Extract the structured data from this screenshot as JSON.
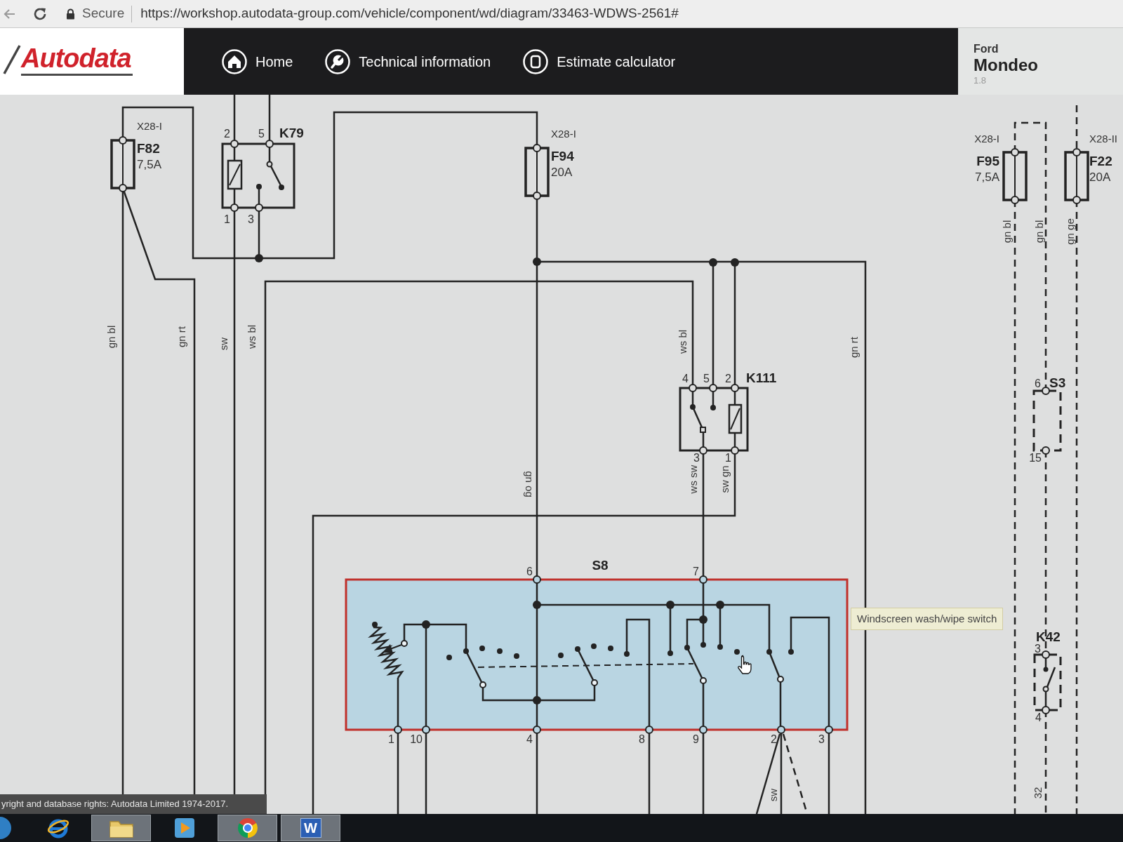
{
  "browser": {
    "security_label": "Secure",
    "url": "https://workshop.autodata-group.com/vehicle/component/wd/diagram/33463-WDWS-2561#"
  },
  "header": {
    "logo": "Autodata",
    "nav": [
      {
        "kind": "home",
        "label": "Home"
      },
      {
        "kind": "wrench",
        "label": "Technical information"
      },
      {
        "kind": "square",
        "label": "Estimate calculator"
      }
    ],
    "vehicle": {
      "make": "Ford",
      "model": "Mondeo",
      "engine": "1.8"
    }
  },
  "diagram": {
    "fuses": [
      {
        "connector": "X28-I",
        "name": "F82",
        "rating": "7,5A"
      },
      {
        "connector": "X28-I",
        "name": "F94",
        "rating": "20A"
      },
      {
        "connector": "X28-I",
        "name": "F95",
        "rating": "7,5A"
      },
      {
        "connector": "X28-II",
        "name": "F22",
        "rating": "20A"
      }
    ],
    "components": [
      {
        "kind": "relay",
        "name": "K79",
        "dashed": false,
        "selected": false,
        "pins": [
          "2",
          "5",
          "1",
          "3"
        ]
      },
      {
        "kind": "relay",
        "name": "K111",
        "dashed": false,
        "selected": false,
        "pins": [
          "4",
          "5",
          "2",
          "3",
          "1"
        ]
      },
      {
        "kind": "switch",
        "name": "S8",
        "dashed": false,
        "selected": true,
        "pins": [
          "6",
          "7",
          "1",
          "10",
          "4",
          "8",
          "9",
          "2",
          "3"
        ]
      },
      {
        "kind": "module",
        "name": "S3",
        "dashed": true,
        "selected": false,
        "pins": [
          "6",
          "15"
        ]
      },
      {
        "kind": "relay",
        "name": "K42",
        "dashed": true,
        "selected": false,
        "pins": [
          "3",
          "4"
        ]
      }
    ],
    "wire_labels": [
      "gn bl",
      "gn rt",
      "sw",
      "ws bl",
      "gn og",
      "ws bl",
      "ws sw",
      "sw gn",
      "gn rt",
      "gn bl",
      "gn bl",
      "gn ge",
      "sw",
      "32"
    ],
    "tooltip": "Windscreen wash/wipe switch"
  },
  "footer": {
    "copyright": "yright and database rights: Autodata Limited 1974-2017."
  },
  "taskbar": [
    {
      "kind": "start",
      "running": false
    },
    {
      "kind": "globe",
      "running": false
    },
    {
      "kind": "folder",
      "running": true
    },
    {
      "kind": "media",
      "running": false
    },
    {
      "kind": "ring",
      "running": true
    },
    {
      "kind": "document",
      "label": "W",
      "running": true
    }
  ]
}
